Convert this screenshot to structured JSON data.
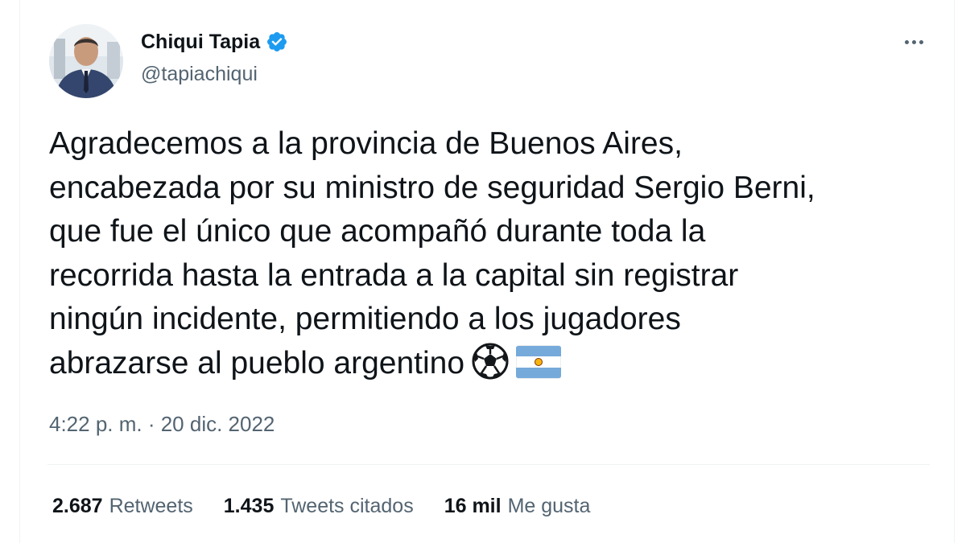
{
  "tweet": {
    "author": {
      "name": "Chiqui Tapia",
      "handle": "@tapiachiqui",
      "verified": true,
      "avatar_icon": "profile-photo"
    },
    "text_lines": [
      "Agradecemos a la provincia de Buenos Aires,",
      "encabezada por su ministro de seguridad Sergio Berni,",
      "que fue el único que acompañó durante toda la",
      "recorrida hasta la entrada a la capital sin registrar",
      "ningún incidente, permitiendo a los jugadores",
      "abrazarse al pueblo argentino"
    ],
    "emojis": [
      "soccer-ball-icon",
      "argentina-flag-icon"
    ],
    "timestamp": "4:22 p. m. · 20 dic. 2022",
    "stats": {
      "retweets_count": "2.687",
      "retweets_label": "Retweets",
      "quotes_count": "1.435",
      "quotes_label": "Tweets citados",
      "likes_count": "16 mil",
      "likes_label": "Me gusta"
    }
  },
  "colors": {
    "text": "#0f1419",
    "secondary": "#536471",
    "verified": "#1d9bf0",
    "divider": "#eff3f4",
    "flag_blue": "#75aadb"
  }
}
